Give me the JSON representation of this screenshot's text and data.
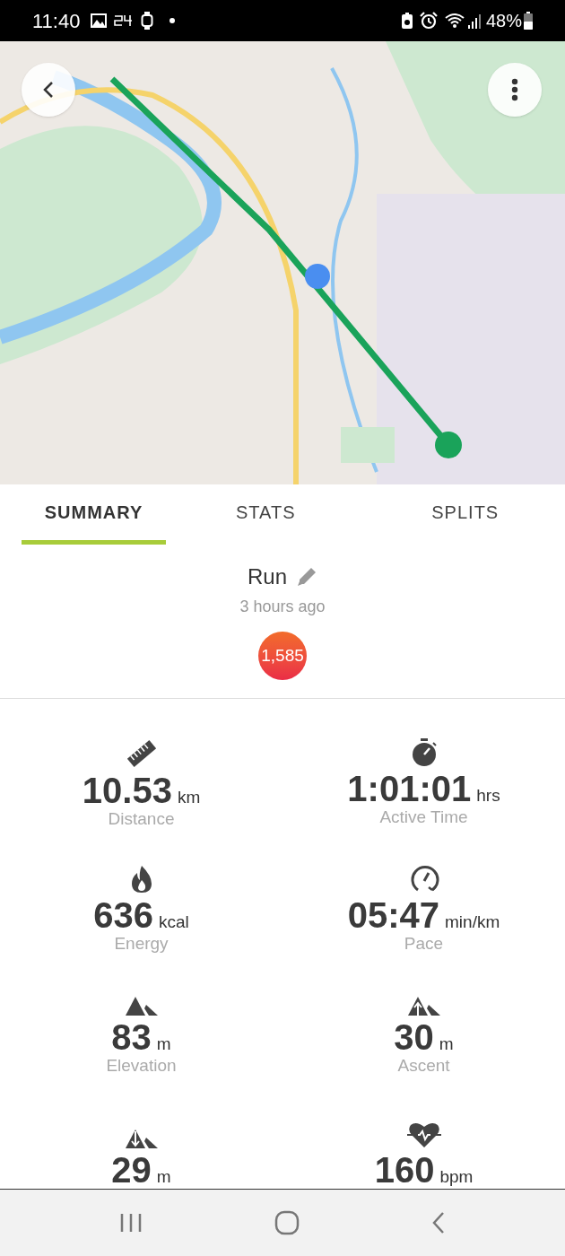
{
  "status_bar": {
    "time": "11:40",
    "battery": "48%"
  },
  "tabs": [
    {
      "label": "SUMMARY",
      "selected": true
    },
    {
      "label": "STATS",
      "selected": false
    },
    {
      "label": "SPLITS",
      "selected": false
    }
  ],
  "activity": {
    "title": "Run",
    "time_ago": "3 hours ago",
    "score": "1,585"
  },
  "stats": [
    {
      "kind": "distance",
      "value": "10.53",
      "unit": "km",
      "label": "Distance"
    },
    {
      "kind": "time",
      "value": "1:01:01",
      "unit": "hrs",
      "label": "Active Time"
    },
    {
      "kind": "energy",
      "value": "636",
      "unit": "kcal",
      "label": "Energy"
    },
    {
      "kind": "pace",
      "value": "05:47",
      "unit": "min/km",
      "label": "Pace"
    },
    {
      "kind": "elevation",
      "value": "83",
      "unit": "m",
      "label": "Elevation"
    },
    {
      "kind": "ascent",
      "value": "30",
      "unit": "m",
      "label": "Ascent"
    },
    {
      "kind": "descent",
      "value": "29",
      "unit": "m"
    },
    {
      "kind": "heart",
      "value": "160",
      "unit": "bpm"
    }
  ]
}
